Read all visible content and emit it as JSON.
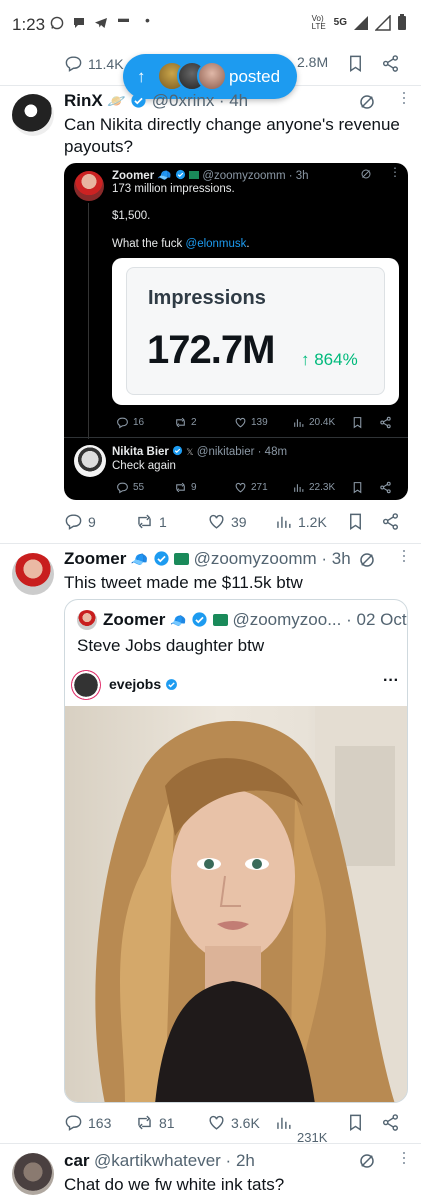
{
  "status_bar": {
    "time": "1:23",
    "network": "5G",
    "lte": "Vo) LTE"
  },
  "prev_tweet": {
    "replies": "11.4K",
    "views": "2.8M"
  },
  "new_posts_pill": {
    "label": "posted"
  },
  "tweet1": {
    "name": "RinX",
    "handle": "@0xrinx",
    "time": "· 4h",
    "text": "Can Nikita directly change anyone's revenue payouts?",
    "replies": "9",
    "reposts": "1",
    "likes": "39",
    "views": "1.2K",
    "embedded": {
      "name": "Zoomer",
      "handle": "@zoomyzoomm · 3h",
      "line1": "173 million impressions.",
      "line2": "$1,500.",
      "line3_prefix": "What the fuck ",
      "line3_mention": "@elonmusk",
      "line3_suffix": ".",
      "card_title": "Impressions",
      "card_value": "172.7M",
      "card_change": "↑ 864%",
      "replies": "16",
      "reposts": "2",
      "likes": "139",
      "views": "20.4K",
      "reply": {
        "name": "Nikita Bier",
        "handle": "@nikitabier · 48m",
        "text": "Check again",
        "replies": "55",
        "reposts": "9",
        "likes": "271",
        "views": "22.3K"
      }
    }
  },
  "tweet2": {
    "name": "Zoomer",
    "handle": "@zoomyzoomm · 3h",
    "text": "This tweet made me $11.5k btw",
    "quote": {
      "name": "Zoomer",
      "handle": "@zoomyzoo...",
      "date": "· 02 Oct",
      "text": "Steve Jobs daughter btw",
      "ig_user": "evejobs"
    },
    "replies": "163",
    "reposts": "81",
    "likes": "3.6K",
    "views": "231K"
  },
  "tweet3": {
    "name": "car",
    "handle": "@kartikwhatever · 2h",
    "text": "Chat do we fw white ink tats?"
  },
  "colors": {
    "accent": "#1d9bf0",
    "verified": "#1d9bf0",
    "green": "#00ba7c",
    "text": "#0f1419",
    "muted": "#536471"
  }
}
